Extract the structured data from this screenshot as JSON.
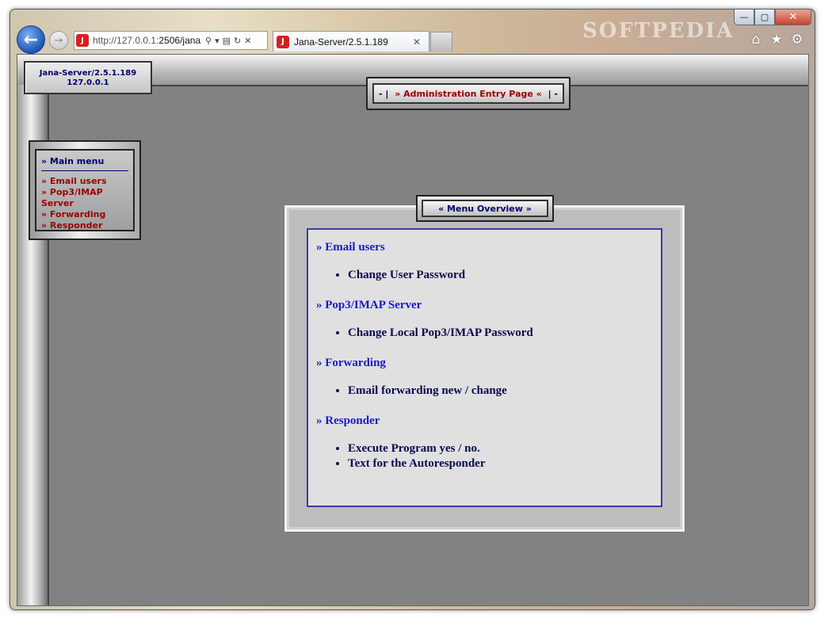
{
  "browser": {
    "url_prefix": "http://127.0.0.1:",
    "url_rest": "2506/jana",
    "tab_title": "Jana-Server/2.5.1.189",
    "watermark": "SOFTPEDIA",
    "favicon_glyph": "J",
    "icons": {
      "back": "back-arrow-icon",
      "forward": "forward-arrow-icon",
      "search": "search-icon",
      "compat": "compatibility-view-icon",
      "refresh": "refresh-icon",
      "stop": "stop-icon",
      "home": "home-icon",
      "favorites": "star-icon",
      "tools": "gear-icon"
    }
  },
  "page": {
    "server_name": "Jana-Server/2.5.1.189",
    "server_ip": "127.0.0.1",
    "title_left_sep": "- |",
    "title": "» Administration Entry Page «",
    "title_right_sep": "| -",
    "menu": {
      "title": "» Main menu",
      "items": [
        {
          "label": "» Email users"
        },
        {
          "label": "» Pop3/IMAP Server"
        },
        {
          "label": "» Forwarding"
        },
        {
          "label": "» Responder"
        }
      ]
    },
    "overview": {
      "tab_label": "« Menu Overview »",
      "sections": [
        {
          "title": "» Email users",
          "items": [
            "Change User Password"
          ]
        },
        {
          "title": "» Pop3/IMAP Server",
          "items": [
            "Change Local Pop3/IMAP Password"
          ]
        },
        {
          "title": "» Forwarding",
          "items": [
            "Email forwarding new / change"
          ]
        },
        {
          "title": "» Responder",
          "items": [
            "Execute Program yes / no.",
            "Text for the Autoresponder"
          ]
        }
      ]
    }
  },
  "colors": {
    "link_red": "#9a0000",
    "heading_blue": "#00006a",
    "section_blue": "#1a1ac8"
  }
}
